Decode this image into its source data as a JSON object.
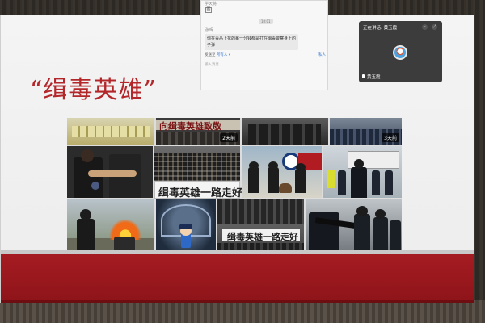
{
  "slide": {
    "title": "“缉毒英雄”",
    "colors": {
      "title": "#b3262a",
      "band": "#a51c22"
    }
  },
  "collage": {
    "photos": [
      {
        "id": "seized-packages",
        "caption": "",
        "badge": ""
      },
      {
        "id": "tribute-banner",
        "caption": "向缉毒英雄致敬",
        "badge": "2天前"
      },
      {
        "id": "police-silhouettes",
        "caption": "",
        "badge": ""
      },
      {
        "id": "blue-crowd",
        "caption": "",
        "badge": "3天前"
      },
      {
        "id": "officers-closeup",
        "caption": "",
        "badge": ""
      },
      {
        "id": "ceremony-ranks",
        "caption": "",
        "badge": ""
      },
      {
        "id": "dog-unit",
        "caption": "",
        "badge": ""
      },
      {
        "id": "armed-officers-sign",
        "caption": "",
        "badge": ""
      },
      {
        "id": "burning-drugs",
        "caption": "",
        "badge": ""
      },
      {
        "id": "cartoon-figure",
        "caption": "",
        "badge": ""
      },
      {
        "id": "farewell-banner",
        "caption": "缉毒英雄一路走好",
        "badge": ""
      },
      {
        "id": "sniper-team",
        "caption": "",
        "badge": ""
      }
    ],
    "banner_large": "缉毒英雄一路走好"
  },
  "chat": {
    "header": "学天将",
    "icon": "图",
    "time": "10:01",
    "sender": "张晖",
    "message": "你在毒品上花的每一分钱都是打在缉毒警察身上的子弹",
    "sent_label": "发送至",
    "audience": "所有人",
    "private_label": "私人",
    "input_placeholder": "输入消息..."
  },
  "speaker": {
    "label": "正在讲话: 黄玉霞",
    "name": "黄玉霞"
  }
}
